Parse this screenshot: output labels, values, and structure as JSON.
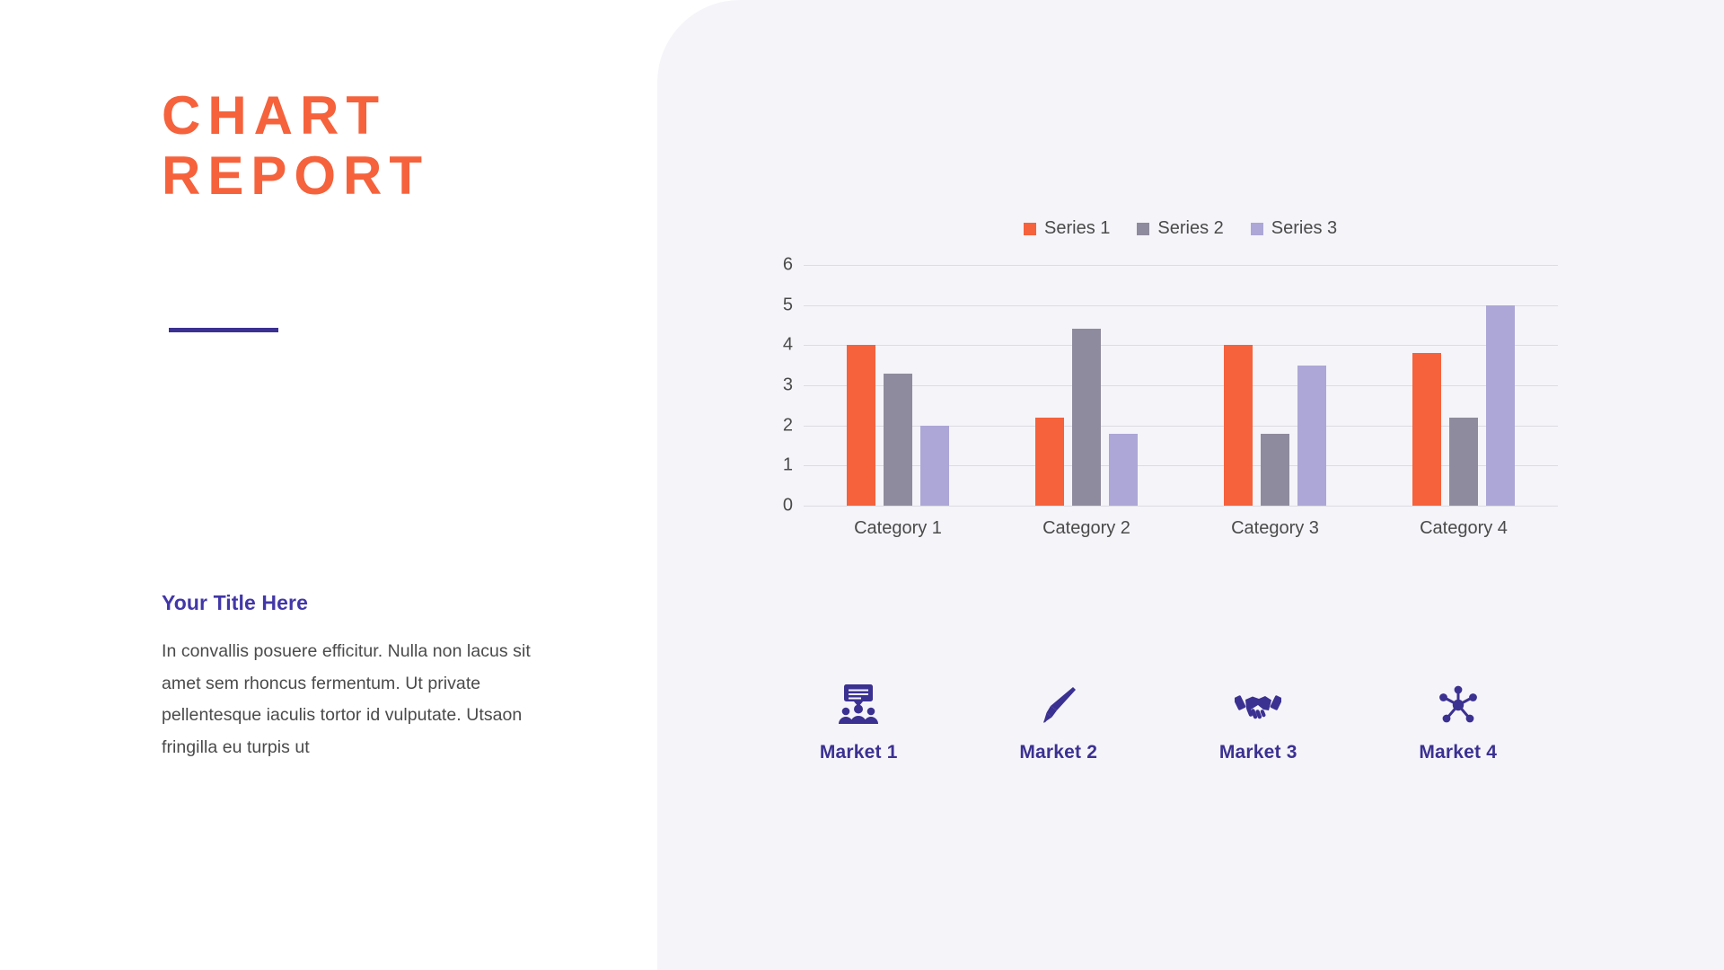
{
  "slide": {
    "background_color": "#ffffff",
    "panel_color": "#f5f4f9"
  },
  "left": {
    "title_line_1": "CHART",
    "title_line_2": "REPORT",
    "title_color": "#f5623c",
    "divider_color": "#3b3191",
    "subtitle": "Your Title Here",
    "subtitle_color": "#4237a8",
    "body": "In convallis posuere efficitur. Nulla non lacus sit amet sem rhoncus fermentum. Ut private pellentesque iaculis tortor id vulputate. Utsaon fringilla eu turpis ut",
    "body_color": "#4a4a4a"
  },
  "chart_data": {
    "type": "bar",
    "title": "",
    "xlabel": "",
    "ylabel": "",
    "ylim": [
      0,
      6
    ],
    "yticks": [
      6,
      5,
      4,
      3,
      2,
      1,
      0
    ],
    "grid": true,
    "legend_position": "top-center",
    "categories": [
      "Category 1",
      "Category 2",
      "Category 3",
      "Category 4"
    ],
    "series": [
      {
        "name": "Series 1",
        "color": "#f5623c",
        "values": [
          4.0,
          2.2,
          4.0,
          3.8
        ]
      },
      {
        "name": "Series 2",
        "color": "#8f8b9e",
        "values": [
          3.3,
          4.4,
          1.8,
          2.2
        ]
      },
      {
        "name": "Series 3",
        "color": "#aca7d6",
        "values": [
          2.0,
          1.8,
          3.5,
          5.0
        ]
      }
    ]
  },
  "markets": {
    "accent_color": "#3b3191",
    "items": [
      {
        "label": "Market 1",
        "icon": "presentation-audience-icon"
      },
      {
        "label": "Market 2",
        "icon": "fountain-pen-icon"
      },
      {
        "label": "Market 3",
        "icon": "handshake-icon"
      },
      {
        "label": "Market 4",
        "icon": "network-hub-icon"
      }
    ]
  }
}
